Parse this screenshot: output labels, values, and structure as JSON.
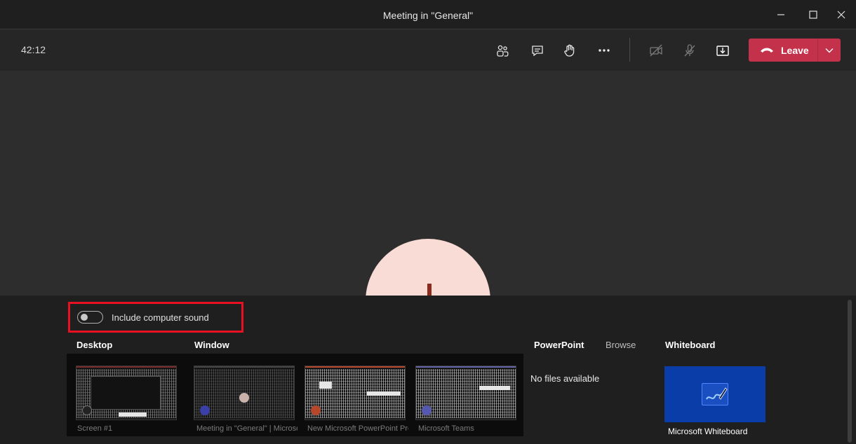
{
  "window": {
    "title": "Meeting in \"General\""
  },
  "toolbar": {
    "timer": "42:12",
    "leave_label": "Leave",
    "leave_color": "#c4314b"
  },
  "tray": {
    "include_sound_label": "Include computer sound",
    "include_sound_on": false,
    "sections": {
      "desktop": "Desktop",
      "window": "Window",
      "powerpoint": "PowerPoint",
      "browse": "Browse",
      "whiteboard": "Whiteboard"
    },
    "no_files": "No files available",
    "thumbnails": [
      {
        "label": "Screen #1"
      },
      {
        "label": "Meeting in \"General\" | Microsoft Teams"
      },
      {
        "label": "New Microsoft PowerPoint Presentation"
      },
      {
        "label": "Microsoft Teams"
      }
    ],
    "whiteboard_label": "Microsoft Whiteboard"
  }
}
